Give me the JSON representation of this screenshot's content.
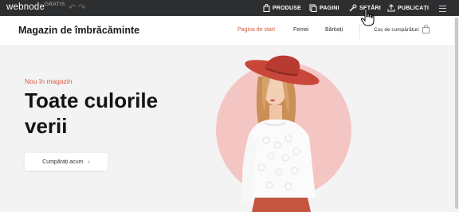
{
  "editor": {
    "logo": "webnode",
    "badge": "GRATIS",
    "toolbar": {
      "products": "PRODUSE",
      "pages": "PAGINI",
      "settings": "SETĂRI",
      "publish": "PUBLICAȚI"
    }
  },
  "site": {
    "brand": "Magazin de îmbrăcăminte",
    "nav": {
      "home": "Pagina de start",
      "women": "Femei",
      "men": "Bărbați"
    },
    "cart": "Coș de cumpărături"
  },
  "hero": {
    "eyebrow": "Nou în magazin",
    "headline": "Toate culorile verii",
    "cta": "Cumpărați acum"
  },
  "colors": {
    "toolbar_bg": "#2d2e30",
    "accent": "#d9593b",
    "hero_bg": "#f3f3f3",
    "circle": "#f3c6c4"
  }
}
